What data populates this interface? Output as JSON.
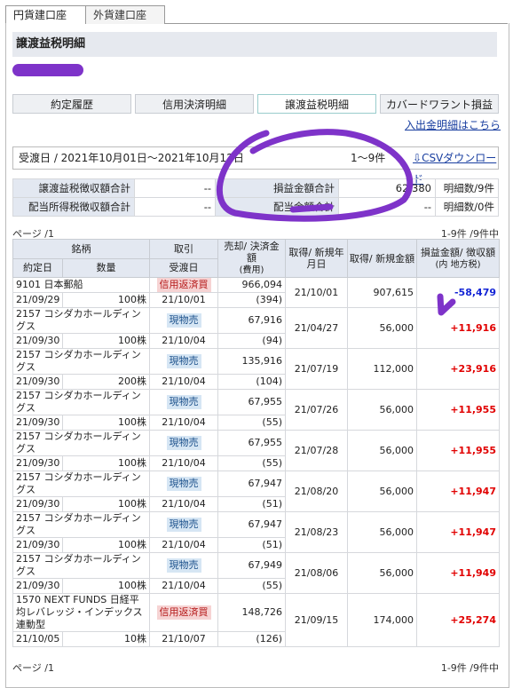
{
  "tabs": [
    {
      "label": "円貨建口座"
    },
    {
      "label": "外貨建口座"
    }
  ],
  "page_title": "譲渡益税明細",
  "nav_buttons": [
    {
      "label": "約定履歴"
    },
    {
      "label": "信用決済明細"
    },
    {
      "label": "譲渡益税明細"
    },
    {
      "label": "カバードワラント損益"
    }
  ],
  "deposit_link": "入出金明細はこちら",
  "period": {
    "label": "受渡日 / 2021年10月01日〜2021年10月12日",
    "count": "1〜9件",
    "csv_link": "CSVダウンロード"
  },
  "summary": {
    "row1": {
      "label": "譲渡益税徴収額合計",
      "value": "--",
      "label2": "損益金額合計",
      "value2": "62,380",
      "count": "明細数/9件"
    },
    "row2": {
      "label": "配当所得税徴収額合計",
      "value": "--",
      "label2": "配当金額合計",
      "value2": "--",
      "count": "明細数/0件"
    }
  },
  "pagination": {
    "top_left": "ページ /1",
    "top_right": "1-9件 /9件中",
    "bottom_left": "ページ /1",
    "bottom_right": "1-9件 /9件中"
  },
  "table": {
    "headers": {
      "stock": "銘柄",
      "trade_date": "約定日",
      "qty": "数量",
      "trade_type": "取引",
      "settle_date": "受渡日",
      "sell_amount": "売却/ 決済金額",
      "fee": "(費用)",
      "acquire_date": "取得/ 新規年月日",
      "acquire_amount": "取得/ 新規金額",
      "pl": "損益金額/ 徴収額",
      "pl_sub": "(内 地方税)"
    },
    "rows": [
      {
        "name": "9101 日本郵船",
        "date": "21/09/29",
        "qty": "100株",
        "type": "信用返済買",
        "settle": "21/10/01",
        "amount": "966,094",
        "fee": "(394)",
        "acq_date": "21/10/01",
        "acq_amount": "907,615",
        "pl": "-58,479"
      },
      {
        "name": "2157 コシダカホールディングス",
        "date": "21/09/30",
        "qty": "100株",
        "type": "現物売",
        "settle": "21/10/04",
        "amount": "67,916",
        "fee": "(94)",
        "acq_date": "21/04/27",
        "acq_amount": "56,000",
        "pl": "+11,916"
      },
      {
        "name": "2157 コシダカホールディングス",
        "date": "21/09/30",
        "qty": "200株",
        "type": "現物売",
        "settle": "21/10/04",
        "amount": "135,916",
        "fee": "(104)",
        "acq_date": "21/07/19",
        "acq_amount": "112,000",
        "pl": "+23,916"
      },
      {
        "name": "2157 コシダカホールディングス",
        "date": "21/09/30",
        "qty": "100株",
        "type": "現物売",
        "settle": "21/10/04",
        "amount": "67,955",
        "fee": "(55)",
        "acq_date": "21/07/26",
        "acq_amount": "56,000",
        "pl": "+11,955"
      },
      {
        "name": "2157 コシダカホールディングス",
        "date": "21/09/30",
        "qty": "100株",
        "type": "現物売",
        "settle": "21/10/04",
        "amount": "67,955",
        "fee": "(55)",
        "acq_date": "21/07/28",
        "acq_amount": "56,000",
        "pl": "+11,955"
      },
      {
        "name": "2157 コシダカホールディングス",
        "date": "21/09/30",
        "qty": "100株",
        "type": "現物売",
        "settle": "21/10/04",
        "amount": "67,947",
        "fee": "(51)",
        "acq_date": "21/08/20",
        "acq_amount": "56,000",
        "pl": "+11,947"
      },
      {
        "name": "2157 コシダカホールディングス",
        "date": "21/09/30",
        "qty": "100株",
        "type": "現物売",
        "settle": "21/10/04",
        "amount": "67,947",
        "fee": "(51)",
        "acq_date": "21/08/23",
        "acq_amount": "56,000",
        "pl": "+11,947"
      },
      {
        "name": "2157 コシダカホールディングス",
        "date": "21/09/30",
        "qty": "100株",
        "type": "現物売",
        "settle": "21/10/04",
        "amount": "67,949",
        "fee": "(55)",
        "acq_date": "21/08/06",
        "acq_amount": "56,000",
        "pl": "+11,949"
      },
      {
        "name": "1570 NEXT FUNDS 日経平均レバレッジ・インデックス連動型",
        "date": "21/10/05",
        "qty": "10株",
        "type": "信用返済買",
        "settle": "21/10/07",
        "amount": "148,726",
        "fee": "(126)",
        "acq_date": "21/09/15",
        "acq_amount": "174,000",
        "pl": "+25,274"
      }
    ]
  },
  "colors": {
    "positive": "#e10000",
    "negative": "#1425d6",
    "annotation": "#7e33c9"
  }
}
